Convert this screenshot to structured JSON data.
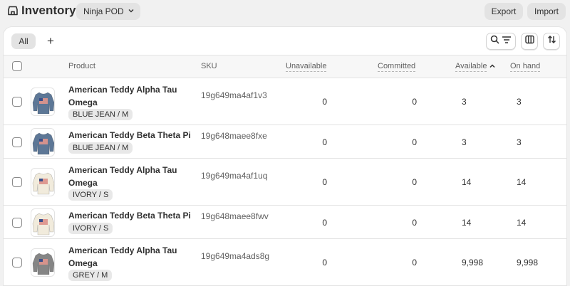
{
  "header": {
    "title": "Inventory",
    "location": "Ninja POD",
    "export_label": "Export",
    "import_label": "Import"
  },
  "views": {
    "tabs": [
      {
        "label": "All",
        "active": true
      }
    ],
    "add_label": "+"
  },
  "table": {
    "columns": {
      "product": "Product",
      "sku": "SKU",
      "unavailable": "Unavailable",
      "committed": "Committed",
      "available": "Available",
      "on_hand": "On hand"
    },
    "sorted_column": "available",
    "rows": [
      {
        "product": "American Teddy Alpha Tau Omega",
        "variant": "BLUE JEAN / M",
        "sku": "19g649ma4af1v3",
        "unavailable": "0",
        "committed": "0",
        "available": "3",
        "on_hand": "3",
        "shirt_color": "#5d7796"
      },
      {
        "product": "American Teddy Beta Theta Pi",
        "variant": "BLUE JEAN / M",
        "sku": "19g648maee8fxe",
        "unavailable": "0",
        "committed": "0",
        "available": "3",
        "on_hand": "3",
        "shirt_color": "#5d7796"
      },
      {
        "product": "American Teddy Alpha Tau Omega",
        "variant": "IVORY / S",
        "sku": "19g649ma4af1uq",
        "unavailable": "0",
        "committed": "0",
        "available": "14",
        "on_hand": "14",
        "shirt_color": "#f1ebdc"
      },
      {
        "product": "American Teddy Beta Theta Pi",
        "variant": "IVORY / S",
        "sku": "19g648maee8fwv",
        "unavailable": "0",
        "committed": "0",
        "available": "14",
        "on_hand": "14",
        "shirt_color": "#f1ebdc"
      },
      {
        "product": "American Teddy Alpha Tau Omega",
        "variant": "GREY / M",
        "sku": "19g649ma4ads8g",
        "unavailable": "0",
        "committed": "0",
        "available": "9,998",
        "on_hand": "9,998",
        "shirt_color": "#858585"
      }
    ]
  },
  "icons": {
    "store": "store-icon",
    "chevron": "chevron-down-icon",
    "search": "search-icon",
    "filter": "filter-icon",
    "columns": "columns-icon",
    "sort": "sort-icon",
    "sort_direction": "caret-up-icon"
  },
  "colors": {
    "background": "#f1f1f1",
    "card": "#ffffff",
    "button": "#e3e3e3",
    "text": "#303030",
    "muted_text": "#616161"
  }
}
